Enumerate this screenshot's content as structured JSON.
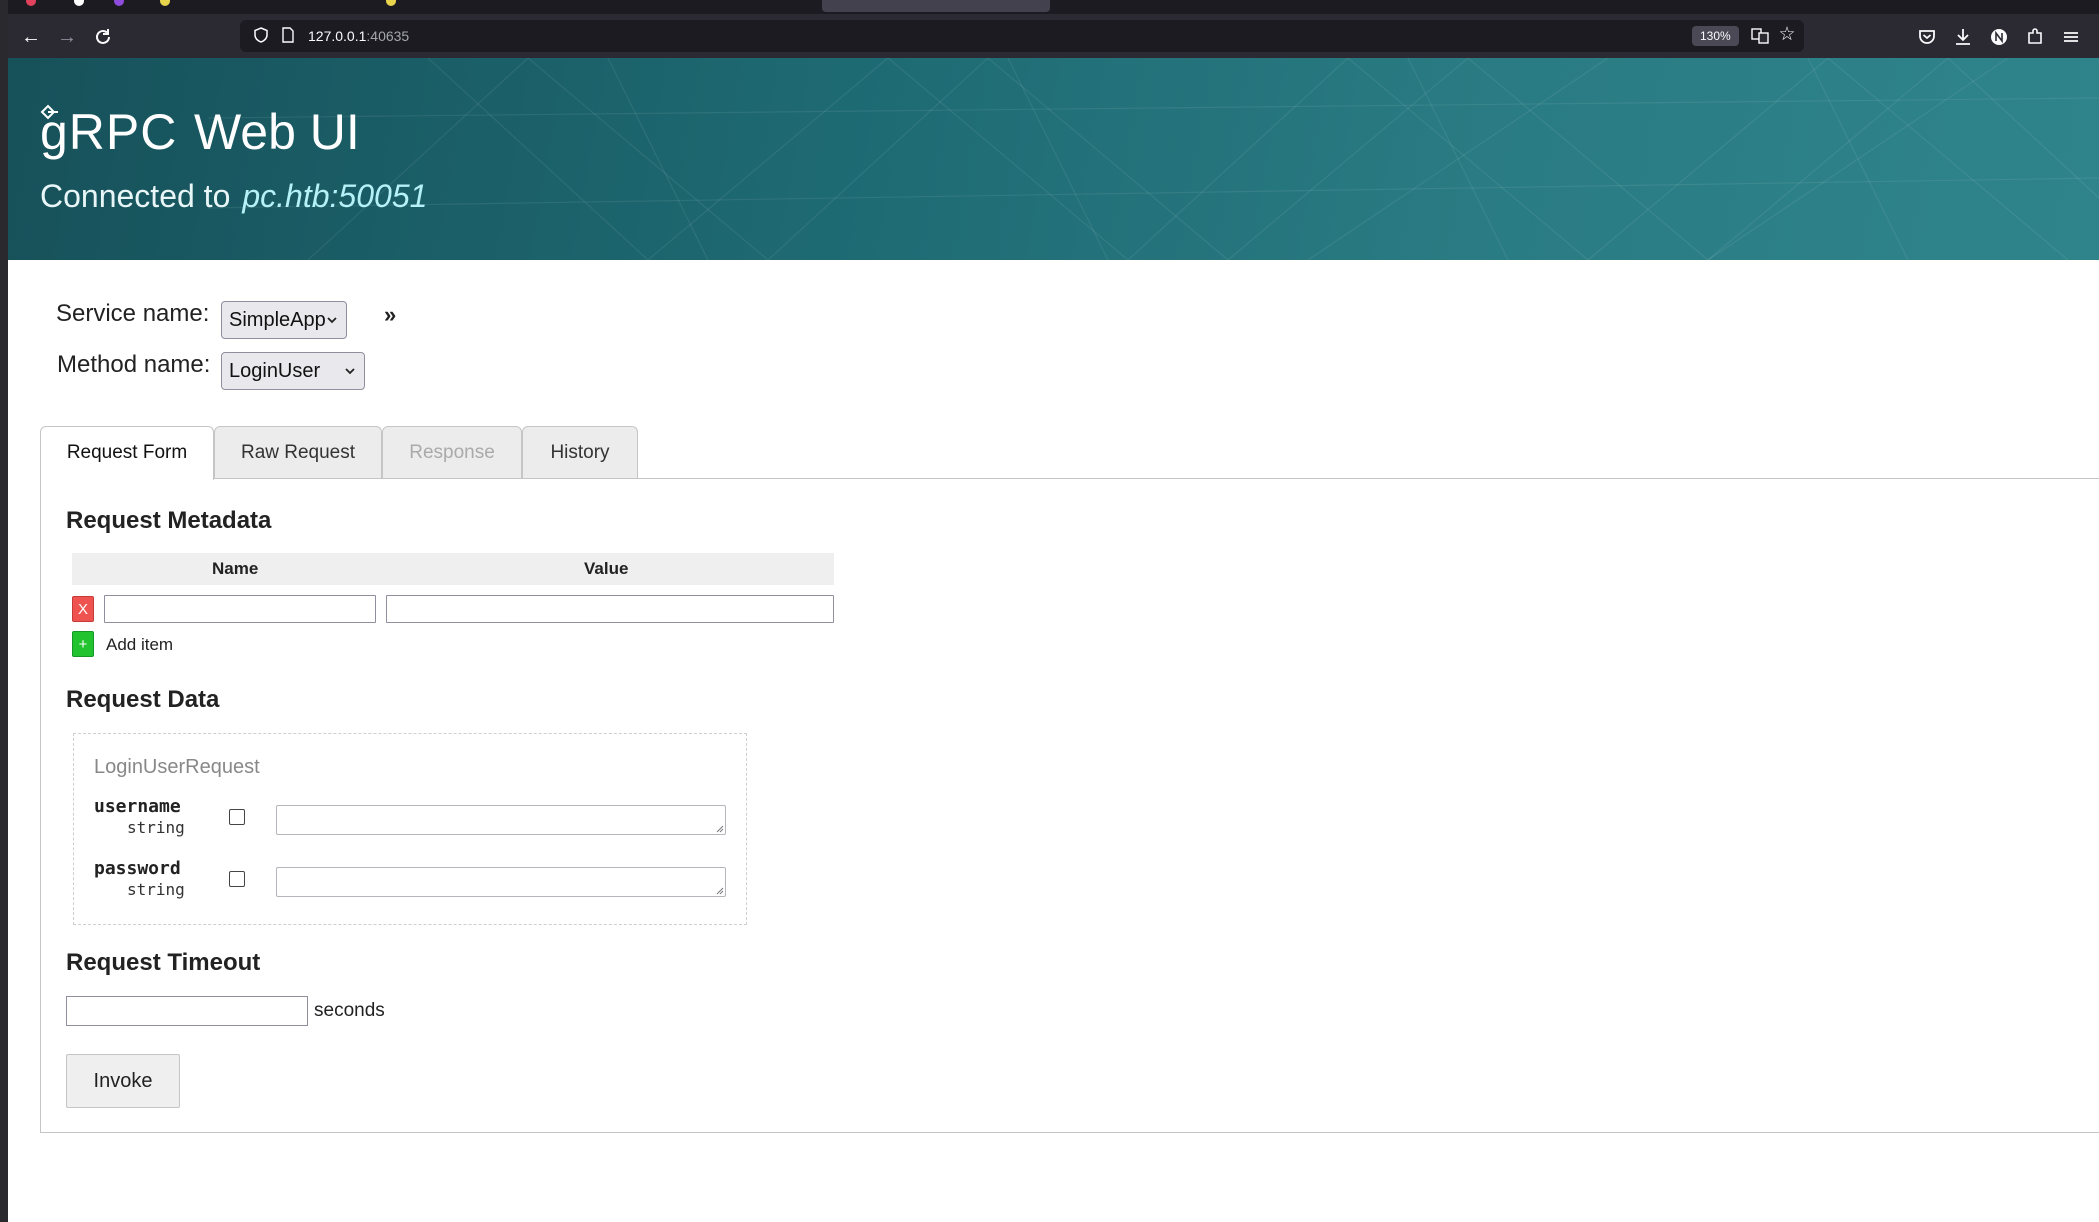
{
  "browser": {
    "url_host": "127.0.0.1",
    "url_port": ":40635",
    "zoom": "130%"
  },
  "header": {
    "logo": "gRPC",
    "title": "Web UI",
    "connected_prefix": "Connected to",
    "connected_host": "pc.htb:50051"
  },
  "form": {
    "service_label": "Service name:",
    "service_value": "SimpleApp",
    "method_label": "Method name:",
    "method_value": "LoginUser",
    "expander": "»"
  },
  "tabs": [
    {
      "label": "Request Form",
      "state": "active"
    },
    {
      "label": "Raw Request",
      "state": "normal"
    },
    {
      "label": "Response",
      "state": "disabled"
    },
    {
      "label": "History",
      "state": "normal"
    }
  ],
  "metadata": {
    "heading": "Request Metadata",
    "col_name": "Name",
    "col_value": "Value",
    "remove_label": "X",
    "add_icon": "+",
    "add_label": "Add item",
    "row_name": "",
    "row_value": ""
  },
  "request_data": {
    "heading": "Request Data",
    "message_type": "LoginUserRequest",
    "fields": [
      {
        "name": "username",
        "type": "string",
        "value": ""
      },
      {
        "name": "password",
        "type": "string",
        "value": ""
      }
    ]
  },
  "timeout": {
    "heading": "Request Timeout",
    "value": "",
    "unit": "seconds"
  },
  "invoke_label": "Invoke",
  "colors": {
    "header_bg": "#1e6a73",
    "remove_button": "#ef5350",
    "add_button": "#21c32e"
  }
}
